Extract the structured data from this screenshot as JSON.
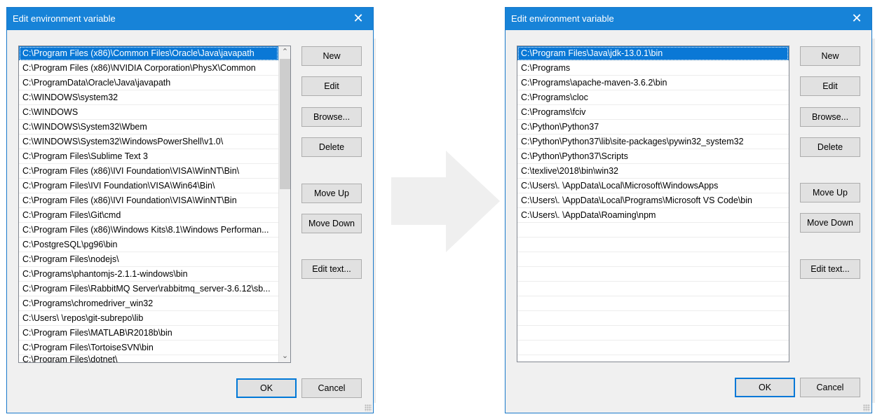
{
  "left_dialog": {
    "title": "Edit environment variable",
    "close_glyph": "✕",
    "scroll_up_glyph": "⌃",
    "scroll_down_glyph": "⌄",
    "entries": [
      "C:\\Program Files (x86)\\Common Files\\Oracle\\Java\\javapath",
      "C:\\Program Files (x86)\\NVIDIA Corporation\\PhysX\\Common",
      "C:\\ProgramData\\Oracle\\Java\\javapath",
      "C:\\WINDOWS\\system32",
      "C:\\WINDOWS",
      "C:\\WINDOWS\\System32\\Wbem",
      "C:\\WINDOWS\\System32\\WindowsPowerShell\\v1.0\\",
      "C:\\Program Files\\Sublime Text 3",
      "C:\\Program Files (x86)\\IVI Foundation\\VISA\\WinNT\\Bin\\",
      "C:\\Program Files\\IVI Foundation\\VISA\\Win64\\Bin\\",
      "C:\\Program Files (x86)\\IVI Foundation\\VISA\\WinNT\\Bin",
      "C:\\Program Files\\Git\\cmd",
      "C:\\Program Files (x86)\\Windows Kits\\8.1\\Windows Performan...",
      "C:\\PostgreSQL\\pg96\\bin",
      "C:\\Program Files\\nodejs\\",
      "C:\\Programs\\phantomjs-2.1.1-windows\\bin",
      "C:\\Program Files\\RabbitMQ Server\\rabbitmq_server-3.6.12\\sb...",
      "C:\\Programs\\chromedriver_win32",
      "C:\\Users\\          \\repos\\git-subrepo\\lib",
      "C:\\Program Files\\MATLAB\\R2018b\\bin",
      "C:\\Program Files\\TortoiseSVN\\bin",
      "C:\\Program Files\\dotnet\\"
    ],
    "buttons": {
      "new": "New",
      "edit": "Edit",
      "browse": "Browse...",
      "delete": "Delete",
      "move_up": "Move Up",
      "move_down": "Move Down",
      "edit_text": "Edit text...",
      "ok": "OK",
      "cancel": "Cancel"
    }
  },
  "right_dialog": {
    "title": "Edit environment variable",
    "close_glyph": "✕",
    "entries": [
      "C:\\Program Files\\Java\\jdk-13.0.1\\bin",
      "C:\\Programs",
      "C:\\Programs\\apache-maven-3.6.2\\bin",
      "C:\\Programs\\cloc",
      "C:\\Programs\\fciv",
      "C:\\Python\\Python37",
      "C:\\Python\\Python37\\lib\\site-packages\\pywin32_system32",
      "C:\\Python\\Python37\\Scripts",
      "C:\\texlive\\2018\\bin\\win32",
      "C:\\Users\\.          \\AppData\\Local\\Microsoft\\WindowsApps",
      "C:\\Users\\.          \\AppData\\Local\\Programs\\Microsoft VS Code\\bin",
      "C:\\Users\\.          \\AppData\\Roaming\\npm",
      "",
      "",
      "",
      "",
      "",
      "",
      "",
      "",
      ""
    ],
    "buttons": {
      "new": "New",
      "edit": "Edit",
      "browse": "Browse...",
      "delete": "Delete",
      "move_up": "Move Up",
      "move_down": "Move Down",
      "edit_text": "Edit text...",
      "ok": "OK",
      "cancel": "Cancel"
    }
  },
  "colors": {
    "titlebar": "#1783d8",
    "selection": "#0a78d6",
    "arrow": "#efefef"
  }
}
